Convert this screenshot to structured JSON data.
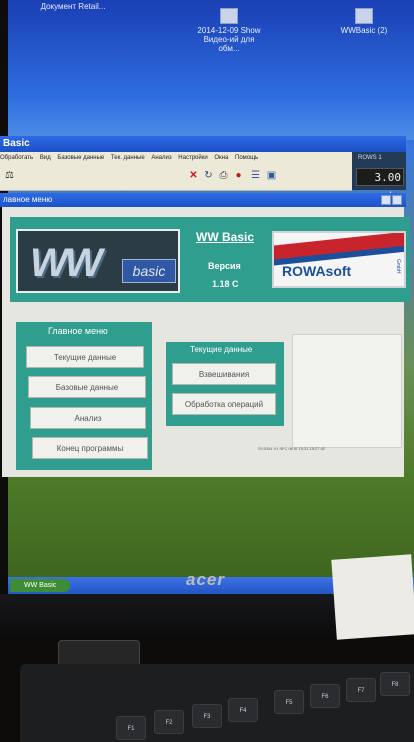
{
  "desktop": {
    "icons": [
      {
        "label": "Документ Retail..."
      },
      {
        "label": "2014-12-09 Show Видео-ий для обм..."
      },
      {
        "label": "WWBasic (2)"
      }
    ]
  },
  "window": {
    "title": "Basic",
    "menu": [
      "Обработать",
      "Вид",
      "Базовые данные",
      "Тек. данные",
      "Анализ",
      "Настройки",
      "Окна",
      "Помощь"
    ],
    "toolbar_icons": [
      "scale-icon",
      "cancel-icon",
      "refresh-icon",
      "print-icon",
      "stop-icon",
      "list-icon",
      "window-icon"
    ],
    "scale": {
      "label": "ROWS 1",
      "value": "3.00 t."
    }
  },
  "app": {
    "inner_title": "лавное меню",
    "logo_ww_text": "WW",
    "logo_basic_text": "basic",
    "name": "WW Basic",
    "version_label": "Версия",
    "version_value": "1.18 C",
    "vendor": "ROWAsoft",
    "vendor_suffix": "GmbH",
    "main_menu": {
      "title": "Главное меню",
      "buttons": [
        "Текущие данные",
        "Базовые данные",
        "Анализ",
        "Конец программы"
      ]
    },
    "current_data": {
      "title": "Текущие данные",
      "buttons": [
        "Взвешивания",
        "Обработка операций"
      ]
    },
    "status_text": "SY2004 V1 SFC 06 III 15:31 15:27:02"
  },
  "taskbar": {
    "start_label": "WW Basic"
  },
  "monitor": {
    "brand": "acer"
  },
  "keyboard": {
    "keys": [
      "F1",
      "F2",
      "F3",
      "F4",
      "F5",
      "F6",
      "F7",
      "F8"
    ]
  }
}
